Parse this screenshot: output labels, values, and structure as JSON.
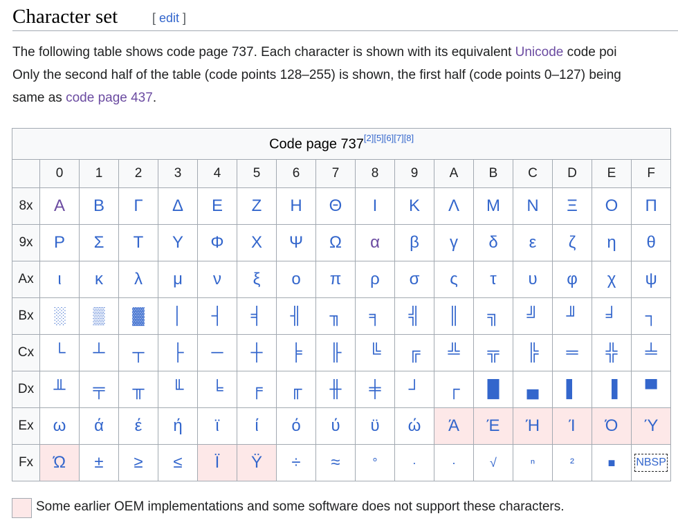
{
  "heading": "Character set",
  "edit_open": "[ ",
  "edit_link": "edit",
  "edit_close": " ]",
  "paragraph": {
    "l1_a": "The following table shows code page 737. Each character is shown with its equivalent ",
    "l1_link": "Unicode",
    "l1_b": " code poi",
    "l2": "Only the second half of the table (code points 128–255) is shown, the first half (code points 0–127) being",
    "l3_a": "same as ",
    "l3_link": "code page 437",
    "l3_b": "."
  },
  "table": {
    "caption": "Code page 737",
    "caption_refs": "[2][5][6][7][8]",
    "columns": [
      "0",
      "1",
      "2",
      "3",
      "4",
      "5",
      "6",
      "7",
      "8",
      "9",
      "A",
      "B",
      "C",
      "D",
      "E",
      "F"
    ],
    "rows": [
      {
        "label": "8x",
        "cells": [
          "Α",
          "Β",
          "Γ",
          "Δ",
          "Ε",
          "Ζ",
          "Η",
          "Θ",
          "Ι",
          "Κ",
          "Λ",
          "Μ",
          "Ν",
          "Ξ",
          "Ο",
          "Π"
        ]
      },
      {
        "label": "9x",
        "cells": [
          "Ρ",
          "Σ",
          "Τ",
          "Υ",
          "Φ",
          "Χ",
          "Ψ",
          "Ω",
          "α",
          "β",
          "γ",
          "δ",
          "ε",
          "ζ",
          "η",
          "θ"
        ]
      },
      {
        "label": "Ax",
        "cells": [
          "ι",
          "κ",
          "λ",
          "μ",
          "ν",
          "ξ",
          "ο",
          "π",
          "ρ",
          "σ",
          "ς",
          "τ",
          "υ",
          "φ",
          "χ",
          "ψ"
        ]
      },
      {
        "label": "Bx",
        "cells": [
          "░",
          "▒",
          "▓",
          "│",
          "┤",
          "╡",
          "╢",
          "╖",
          "╕",
          "╣",
          "║",
          "╗",
          "╝",
          "╜",
          "╛",
          "┐"
        ]
      },
      {
        "label": "Cx",
        "cells": [
          "└",
          "┴",
          "┬",
          "├",
          "─",
          "┼",
          "╞",
          "╟",
          "╚",
          "╔",
          "╩",
          "╦",
          "╠",
          "═",
          "╬",
          "╧"
        ]
      },
      {
        "label": "Dx",
        "cells": [
          "╨",
          "╤",
          "╥",
          "╙",
          "╘",
          "╒",
          "╓",
          "╫",
          "╪",
          "┘",
          "┌",
          "█",
          "▄",
          "▌",
          "▐",
          "▀"
        ]
      },
      {
        "label": "Ex",
        "cells": [
          "ω",
          "ά",
          "έ",
          "ή",
          "ϊ",
          "ί",
          "ό",
          "ύ",
          "ϋ",
          "ώ",
          "Ά",
          "Έ",
          "Ή",
          "Ί",
          "Ό",
          "Ύ"
        ]
      },
      {
        "label": "Fx",
        "cells": [
          "Ώ",
          "±",
          "≥",
          "≤",
          "Ϊ",
          "Ϋ",
          "÷",
          "≈",
          "°",
          "∙",
          "·",
          "√",
          "ⁿ",
          "²",
          "■",
          "NBSP"
        ]
      }
    ]
  },
  "legend": "Some earlier OEM implementations and some software does not support these characters.",
  "colors": {
    "link": "#3366cc",
    "visited": "#6b4ba1",
    "highlight": "#fde8e8",
    "border": "#a2a9b1"
  }
}
